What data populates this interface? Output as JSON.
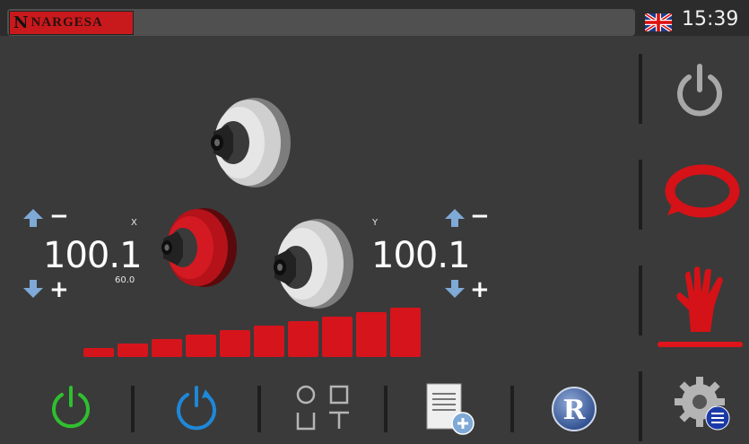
{
  "header": {
    "brand": "NARGESA",
    "brand_mark": "N",
    "time": "15:39",
    "language_icon": "uk-flag-icon"
  },
  "axes": {
    "x": {
      "label": "X",
      "value": "100.1",
      "sub_value": "60.0",
      "minus": "−",
      "plus": "+"
    },
    "y": {
      "label": "Y",
      "value": "100.1",
      "minus": "−",
      "plus": "+"
    }
  },
  "speed_level": {
    "segments": 10,
    "active": 10
  },
  "sidebar": {
    "items": [
      {
        "name": "power-off-icon"
      },
      {
        "name": "cycle-mode-icon"
      },
      {
        "name": "manual-mode-icon",
        "selected": true
      },
      {
        "name": "settings-icon"
      }
    ]
  },
  "toolbar": {
    "items": [
      {
        "name": "start-power-icon"
      },
      {
        "name": "reset-icon"
      },
      {
        "name": "profile-shapes-icon"
      },
      {
        "name": "new-program-icon"
      },
      {
        "name": "registered-icon",
        "text": "R"
      }
    ]
  },
  "colors": {
    "accent_red": "#e0151b",
    "green": "#2fbf2f",
    "blue": "#1e88d8",
    "background": "#3a3a3a"
  }
}
